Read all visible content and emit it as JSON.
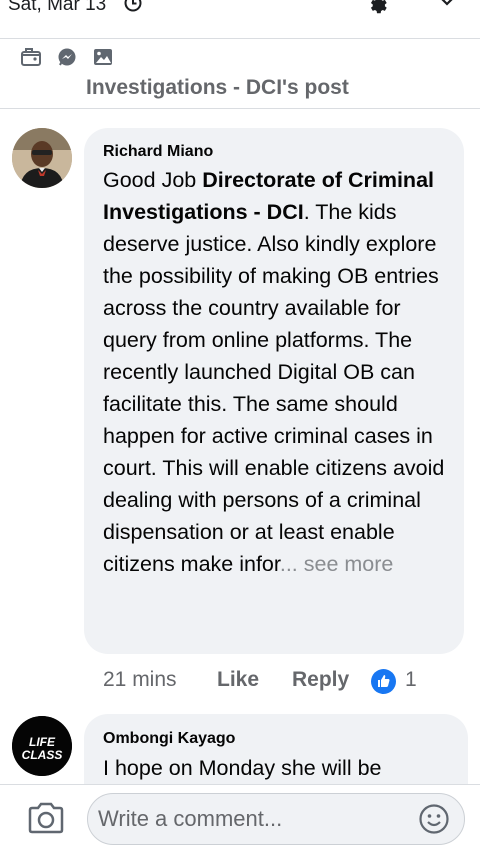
{
  "status": {
    "date": "Sat, Mar 13"
  },
  "post_header": {
    "title": "Investigations - DCI's post"
  },
  "comments": [
    {
      "author": "Richard Miano",
      "text_prefix": "Good Job ",
      "mention": "Directorate of Criminal Investigations - DCI",
      "text_body": ". The kids deserve justice.  Also kindly explore the possibility of making OB entries across the country available for query from online platforms. The recently launched Digital OB can facilitate this. The same should happen for active criminal cases in court. This will enable citizens avoid dealing with persons of a criminal dispensation or at least enable citizens make infor",
      "ellipsis": "...",
      "see_more": " see more",
      "time": "21 mins",
      "like_label": "Like",
      "reply_label": "Reply",
      "like_count": "1"
    },
    {
      "author": "Ombongi Kayago",
      "avatar_text_1": "LIFE",
      "avatar_text_2": "CLASS",
      "text": "I hope on Monday she will be"
    }
  ],
  "composer": {
    "placeholder": "Write a comment..."
  },
  "colors": {
    "bubble": "#f0f2f5",
    "accent": "#1877f2",
    "meta": "#65676b"
  },
  "icons": [
    "clock-icon",
    "gear-icon",
    "chevron-down-icon",
    "tag-icon",
    "messenger-icon",
    "photo-icon",
    "thumbs-up-icon",
    "camera-icon",
    "smiley-icon"
  ]
}
